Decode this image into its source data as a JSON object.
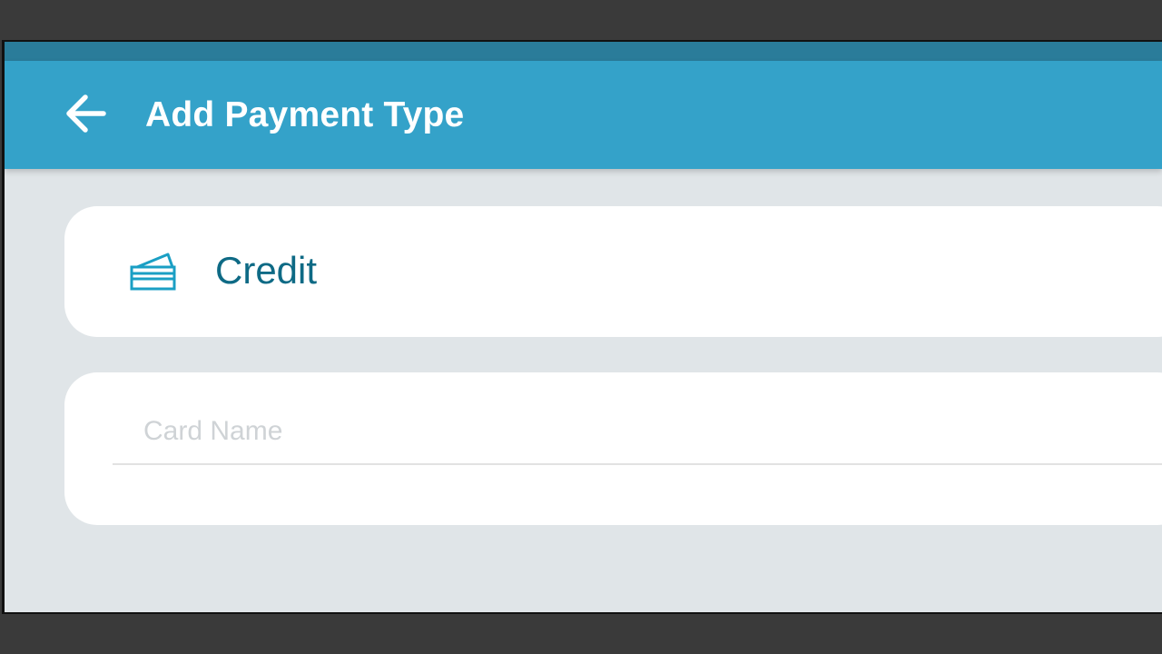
{
  "app_bar": {
    "title": "Add Payment Type",
    "back_icon": "arrow-left-icon",
    "color": "#34a2c9",
    "status_bar_color": "#2a7c9a"
  },
  "payment_type": {
    "label": "Credit",
    "icon": "credit-card-icon",
    "accent_color": "#0e6a85"
  },
  "card_name_field": {
    "placeholder": "Card Name",
    "value": ""
  }
}
